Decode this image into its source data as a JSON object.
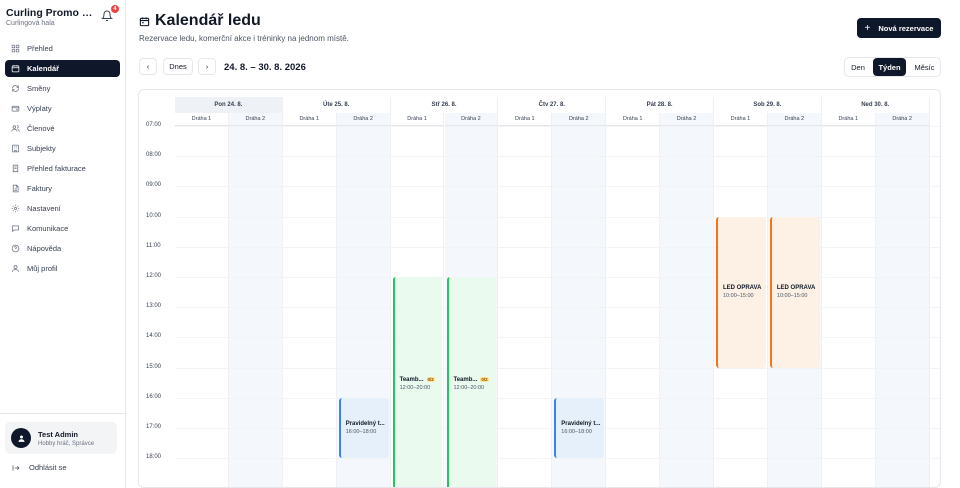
{
  "brand": {
    "title": "Curling Promo Os...",
    "subtitle": "Curlingová hala",
    "notification_count": "4"
  },
  "nav": [
    {
      "label": "Přehled",
      "icon": "grid-icon"
    },
    {
      "label": "Kalendář",
      "icon": "calendar-icon",
      "active": true
    },
    {
      "label": "Směny",
      "icon": "shift-icon"
    },
    {
      "label": "Výplaty",
      "icon": "wallet-icon"
    },
    {
      "label": "Členové",
      "icon": "users-icon"
    },
    {
      "label": "Subjekty",
      "icon": "building-icon"
    },
    {
      "label": "Přehled fakturace",
      "icon": "receipt-icon"
    },
    {
      "label": "Faktury",
      "icon": "document-icon"
    },
    {
      "label": "Nastavení",
      "icon": "gear-icon"
    },
    {
      "label": "Komunikace",
      "icon": "chat-icon"
    },
    {
      "label": "Nápověda",
      "icon": "help-icon"
    },
    {
      "label": "Můj profil",
      "icon": "user-icon"
    }
  ],
  "user": {
    "name": "Test Admin",
    "role": "Hobby hráč, Správce",
    "logout_label": "Odhlásit se"
  },
  "page": {
    "title": "Kalendář ledu",
    "subtitle": "Rezervace ledu, komerční akce i tréninky na jednom místě.",
    "new_button": "Nová rezervace"
  },
  "toolbar": {
    "prev": "‹",
    "today": "Dnes",
    "next": "›",
    "range": "24. 8. – 30. 8. 2026",
    "views": [
      "Den",
      "Týden",
      "Měsíc"
    ],
    "active_view": "Týden"
  },
  "calendar": {
    "days": [
      "Pon 24. 8.",
      "Úte 25. 8.",
      "Stř 26. 8.",
      "Čtv 27. 8.",
      "Pát 28. 8.",
      "Sob 29. 8.",
      "Ned 30. 8."
    ],
    "lanes": [
      "Dráha 1",
      "Dráha 2"
    ],
    "hours": [
      "07:00",
      "08:00",
      "09:00",
      "10:00",
      "11:00",
      "12:00",
      "13:00",
      "14:00",
      "15:00",
      "16:00",
      "17:00",
      "18:00"
    ],
    "events": [
      {
        "title": "Pravidelný t...",
        "time": "16:00–18:00",
        "day": 1,
        "lane": 1,
        "start": 16,
        "end": 18,
        "kind": "training"
      },
      {
        "title": "Teamb...",
        "badge": "0/2",
        "time": "12:00–20:00",
        "day": 2,
        "lane": 0,
        "start": 12,
        "end": 20,
        "kind": "teambuilding"
      },
      {
        "title": "Teamb...",
        "badge": "0/2",
        "time": "12:00–20:00",
        "day": 2,
        "lane": 1,
        "start": 12,
        "end": 20,
        "kind": "teambuilding"
      },
      {
        "title": "Pravidelný t...",
        "time": "16:00–18:00",
        "day": 3,
        "lane": 1,
        "start": 16,
        "end": 18,
        "kind": "training"
      },
      {
        "title": "LED OPRAVA",
        "time": "10:00–15:00",
        "day": 5,
        "lane": 0,
        "start": 10,
        "end": 15,
        "kind": "maintenance"
      },
      {
        "title": "LED OPRAVA",
        "time": "10:00–15:00",
        "day": 5,
        "lane": 1,
        "start": 10,
        "end": 15,
        "kind": "maintenance"
      }
    ]
  }
}
